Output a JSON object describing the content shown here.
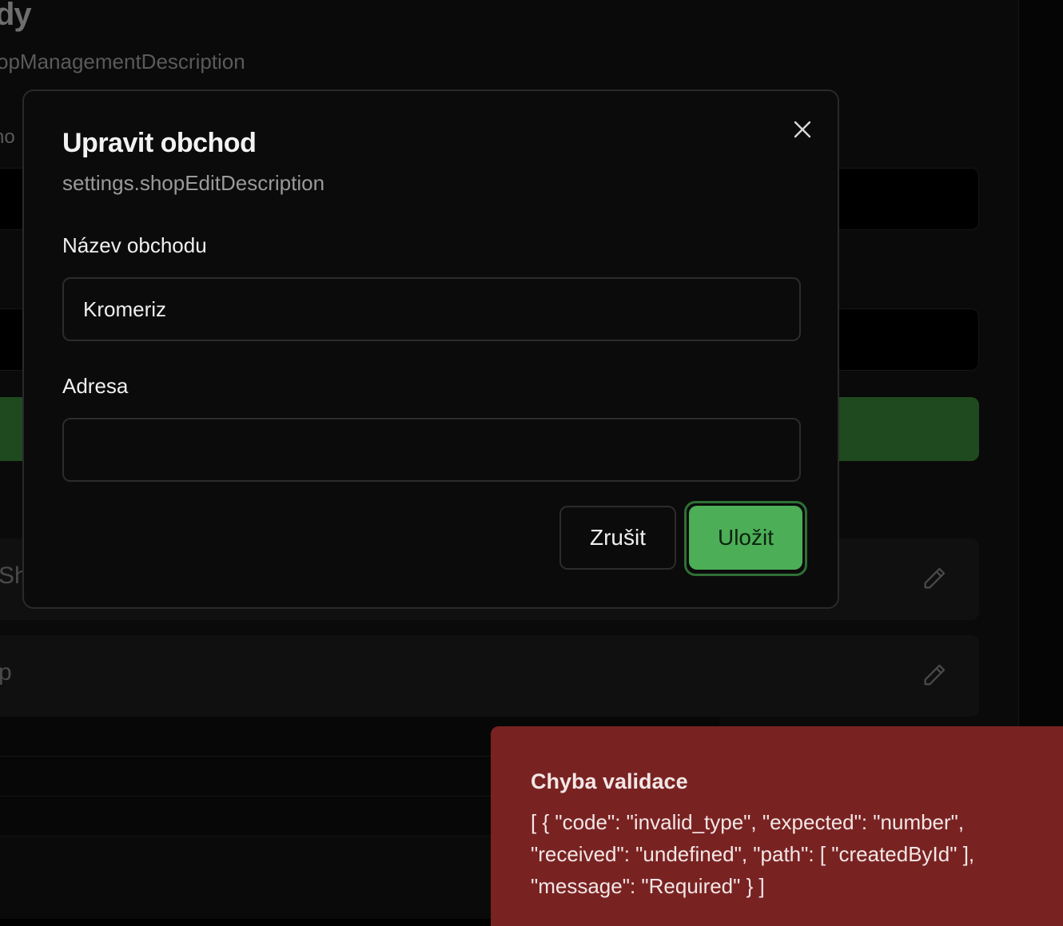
{
  "background": {
    "page_title": "dy",
    "page_subtitle": "opManagementDescription",
    "section_label": "no",
    "shop_cards": [
      {
        "name": "Sh"
      },
      {
        "name": "p"
      }
    ]
  },
  "dialog": {
    "title": "Upravit obchod",
    "description": "settings.shopEditDescription",
    "shop_name_label": "Název obchodu",
    "shop_name_value": "Kromeriz",
    "address_label": "Adresa",
    "address_value": "",
    "cancel_label": "Zrušit",
    "save_label": "Uložit"
  },
  "toast": {
    "title": "Chyba validace",
    "message": "[ { \"code\": \"invalid_type\", \"expected\": \"number\", \"received\": \"undefined\", \"path\": [ \"createdById\" ], \"message\": \"Required\" } ]"
  },
  "colors": {
    "accent_green": "#4cae57",
    "toast_red": "#782322"
  },
  "icons": {
    "close": "close-icon",
    "edit": "pencil-icon"
  }
}
